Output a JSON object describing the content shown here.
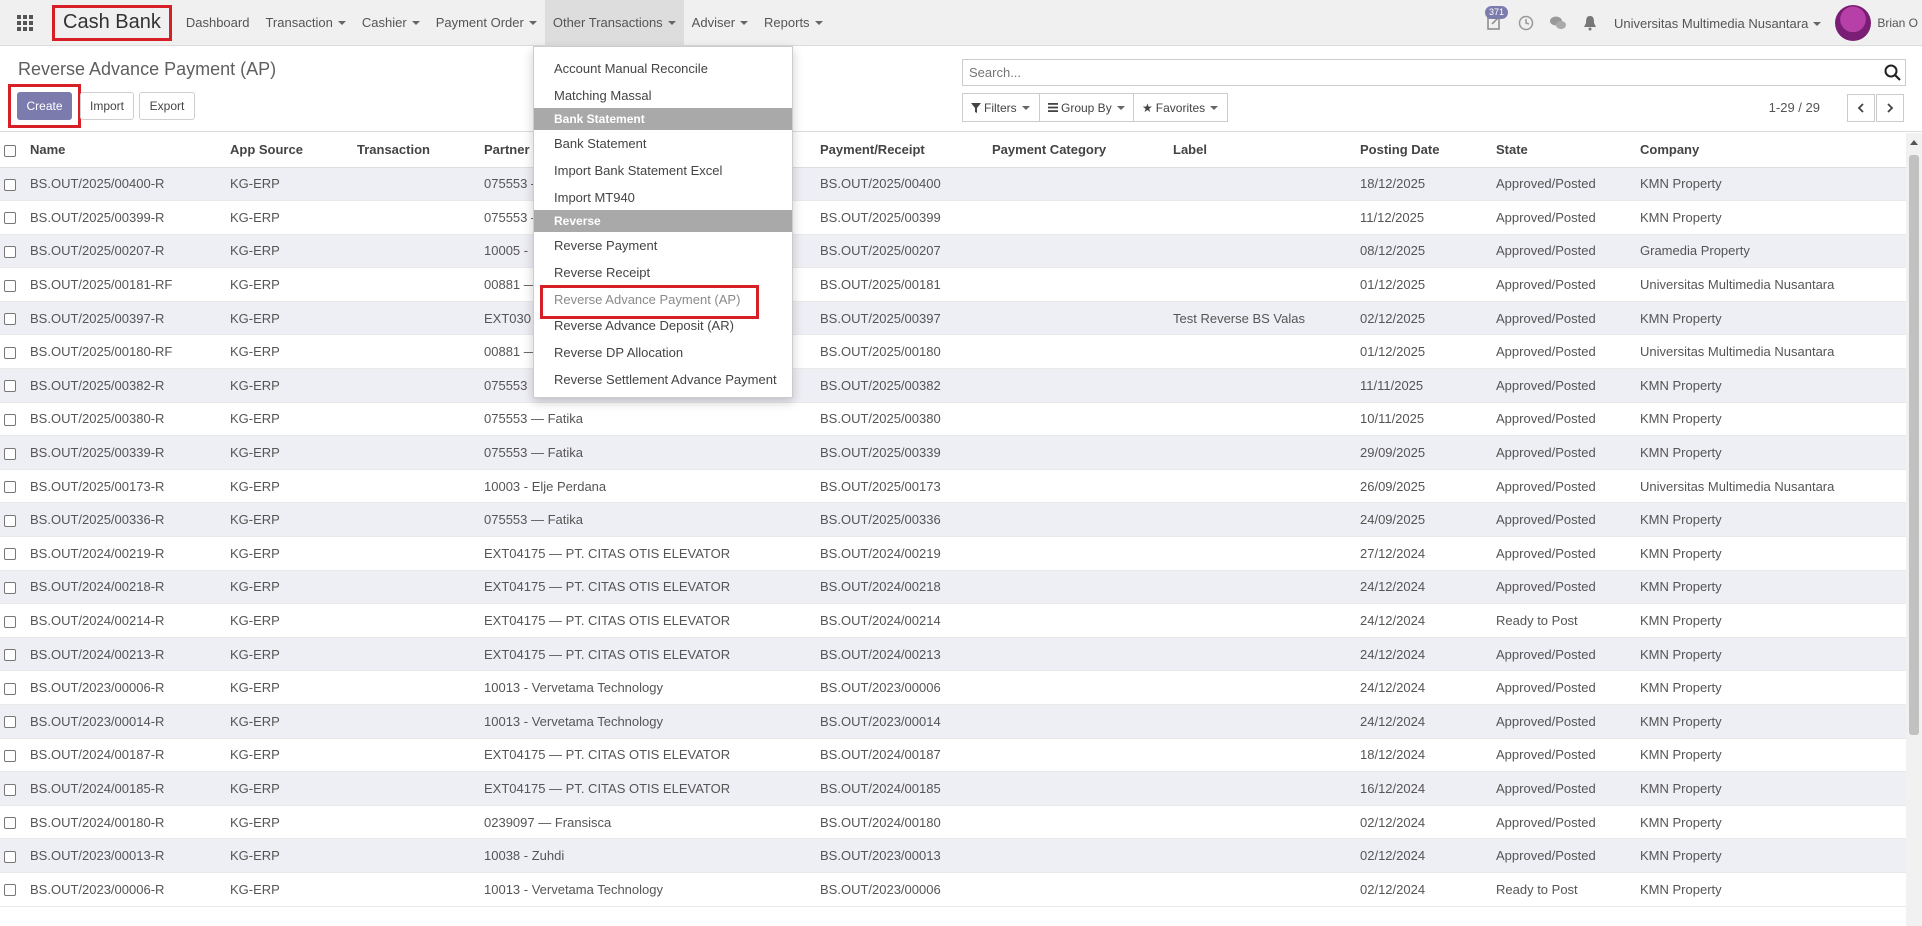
{
  "app_title": "Cash Bank",
  "nav": [
    {
      "label": "Dashboard",
      "dropdown": false
    },
    {
      "label": "Transaction",
      "dropdown": true
    },
    {
      "label": "Cashier",
      "dropdown": true
    },
    {
      "label": "Payment Order",
      "dropdown": true
    },
    {
      "label": "Other Transactions",
      "dropdown": true
    },
    {
      "label": "Adviser",
      "dropdown": true
    },
    {
      "label": "Reports",
      "dropdown": true
    }
  ],
  "systray": {
    "activity_count": "371",
    "company": "Universitas Multimedia Nusantara",
    "user": "Brian O"
  },
  "page": {
    "breadcrumb": "Reverse Advance Payment (AP)",
    "create_label": "Create",
    "import_label": "Import",
    "export_label": "Export",
    "search_placeholder": "Search...",
    "filters_label": "Filters",
    "groupby_label": "Group By",
    "favorites_label": "Favorites",
    "pager": "1-29 / 29"
  },
  "dropdown": {
    "items": [
      {
        "type": "item",
        "label": "Account Manual Reconcile"
      },
      {
        "type": "item",
        "label": "Matching Massal"
      },
      {
        "type": "header",
        "label": "Bank Statement"
      },
      {
        "type": "item",
        "label": "Bank Statement"
      },
      {
        "type": "item",
        "label": "Import Bank Statement Excel"
      },
      {
        "type": "item",
        "label": "Import MT940"
      },
      {
        "type": "header",
        "label": "Reverse"
      },
      {
        "type": "item",
        "label": "Reverse Payment"
      },
      {
        "type": "item",
        "label": "Reverse Receipt"
      },
      {
        "type": "item",
        "label": "Reverse Advance Payment (AP)",
        "highlight": true
      },
      {
        "type": "item",
        "label": "Reverse Advance Deposit (AR)"
      },
      {
        "type": "item",
        "label": "Reverse DP Allocation"
      },
      {
        "type": "item",
        "label": "Reverse Settlement Advance Payment"
      }
    ]
  },
  "table": {
    "columns": [
      "Name",
      "App Source",
      "Transaction",
      "Partner",
      "Payment/Receipt",
      "Payment Category",
      "Label",
      "Posting Date",
      "State",
      "Company"
    ],
    "rows": [
      [
        "BS.OUT/2025/00400-R",
        "KG-ERP",
        "",
        "075553 —",
        "BS.OUT/2025/00400",
        "",
        "",
        "18/12/2025",
        "Approved/Posted",
        "KMN Property"
      ],
      [
        "BS.OUT/2025/00399-R",
        "KG-ERP",
        "",
        "075553 —",
        "BS.OUT/2025/00399",
        "",
        "",
        "11/12/2025",
        "Approved/Posted",
        "KMN Property"
      ],
      [
        "BS.OUT/2025/00207-R",
        "KG-ERP",
        "",
        "10005 -",
        "BS.OUT/2025/00207",
        "",
        "",
        "08/12/2025",
        "Approved/Posted",
        "Gramedia Property"
      ],
      [
        "BS.OUT/2025/00181-RF",
        "KG-ERP",
        "",
        "00881 —",
        "BS.OUT/2025/00181",
        "",
        "",
        "01/12/2025",
        "Approved/Posted",
        "Universitas Multimedia Nusantara"
      ],
      [
        "BS.OUT/2025/00397-R",
        "KG-ERP",
        "",
        "EXT030",
        "BS.OUT/2025/00397",
        "",
        "Test Reverse BS Valas",
        "02/12/2025",
        "Approved/Posted",
        "KMN Property"
      ],
      [
        "BS.OUT/2025/00180-RF",
        "KG-ERP",
        "",
        "00881 —",
        "BS.OUT/2025/00180",
        "",
        "",
        "01/12/2025",
        "Approved/Posted",
        "Universitas Multimedia Nusantara"
      ],
      [
        "BS.OUT/2025/00382-R",
        "KG-ERP",
        "",
        "075553",
        "BS.OUT/2025/00382",
        "",
        "",
        "11/11/2025",
        "Approved/Posted",
        "KMN Property"
      ],
      [
        "BS.OUT/2025/00380-R",
        "KG-ERP",
        "",
        "075553 — Fatika",
        "BS.OUT/2025/00380",
        "",
        "",
        "10/11/2025",
        "Approved/Posted",
        "KMN Property"
      ],
      [
        "BS.OUT/2025/00339-R",
        "KG-ERP",
        "",
        "075553 — Fatika",
        "BS.OUT/2025/00339",
        "",
        "",
        "29/09/2025",
        "Approved/Posted",
        "KMN Property"
      ],
      [
        "BS.OUT/2025/00173-R",
        "KG-ERP",
        "",
        "10003 - Elje Perdana",
        "BS.OUT/2025/00173",
        "",
        "",
        "26/09/2025",
        "Approved/Posted",
        "Universitas Multimedia Nusantara"
      ],
      [
        "BS.OUT/2025/00336-R",
        "KG-ERP",
        "",
        "075553 — Fatika",
        "BS.OUT/2025/00336",
        "",
        "",
        "24/09/2025",
        "Approved/Posted",
        "KMN Property"
      ],
      [
        "BS.OUT/2024/00219-R",
        "KG-ERP",
        "",
        "EXT04175 — PT. CITAS OTIS ELEVATOR",
        "BS.OUT/2024/00219",
        "",
        "",
        "27/12/2024",
        "Approved/Posted",
        "KMN Property"
      ],
      [
        "BS.OUT/2024/00218-R",
        "KG-ERP",
        "",
        "EXT04175 — PT. CITAS OTIS ELEVATOR",
        "BS.OUT/2024/00218",
        "",
        "",
        "24/12/2024",
        "Approved/Posted",
        "KMN Property"
      ],
      [
        "BS.OUT/2024/00214-R",
        "KG-ERP",
        "",
        "EXT04175 — PT. CITAS OTIS ELEVATOR",
        "BS.OUT/2024/00214",
        "",
        "",
        "24/12/2024",
        "Ready to Post",
        "KMN Property"
      ],
      [
        "BS.OUT/2024/00213-R",
        "KG-ERP",
        "",
        "EXT04175 — PT. CITAS OTIS ELEVATOR",
        "BS.OUT/2024/00213",
        "",
        "",
        "24/12/2024",
        "Approved/Posted",
        "KMN Property"
      ],
      [
        "BS.OUT/2023/00006-R",
        "KG-ERP",
        "",
        "10013 - Vervetama Technology",
        "BS.OUT/2023/00006",
        "",
        "",
        "24/12/2024",
        "Approved/Posted",
        "KMN Property"
      ],
      [
        "BS.OUT/2023/00014-R",
        "KG-ERP",
        "",
        "10013 - Vervetama Technology",
        "BS.OUT/2023/00014",
        "",
        "",
        "24/12/2024",
        "Approved/Posted",
        "KMN Property"
      ],
      [
        "BS.OUT/2024/00187-R",
        "KG-ERP",
        "",
        "EXT04175 — PT. CITAS OTIS ELEVATOR",
        "BS.OUT/2024/00187",
        "",
        "",
        "18/12/2024",
        "Approved/Posted",
        "KMN Property"
      ],
      [
        "BS.OUT/2024/00185-R",
        "KG-ERP",
        "",
        "EXT04175 — PT. CITAS OTIS ELEVATOR",
        "BS.OUT/2024/00185",
        "",
        "",
        "16/12/2024",
        "Approved/Posted",
        "KMN Property"
      ],
      [
        "BS.OUT/2024/00180-R",
        "KG-ERP",
        "",
        "0239097 — Fransisca",
        "BS.OUT/2024/00180",
        "",
        "",
        "02/12/2024",
        "Approved/Posted",
        "KMN Property"
      ],
      [
        "BS.OUT/2023/00013-R",
        "KG-ERP",
        "",
        "10038 - Zuhdi",
        "BS.OUT/2023/00013",
        "",
        "",
        "02/12/2024",
        "Approved/Posted",
        "KMN Property"
      ],
      [
        "BS.OUT/2023/00006-R",
        "KG-ERP",
        "",
        "10013 - Vervetama Technology",
        "BS.OUT/2023/00006",
        "",
        "",
        "02/12/2024",
        "Ready to Post",
        "KMN Property"
      ]
    ]
  }
}
